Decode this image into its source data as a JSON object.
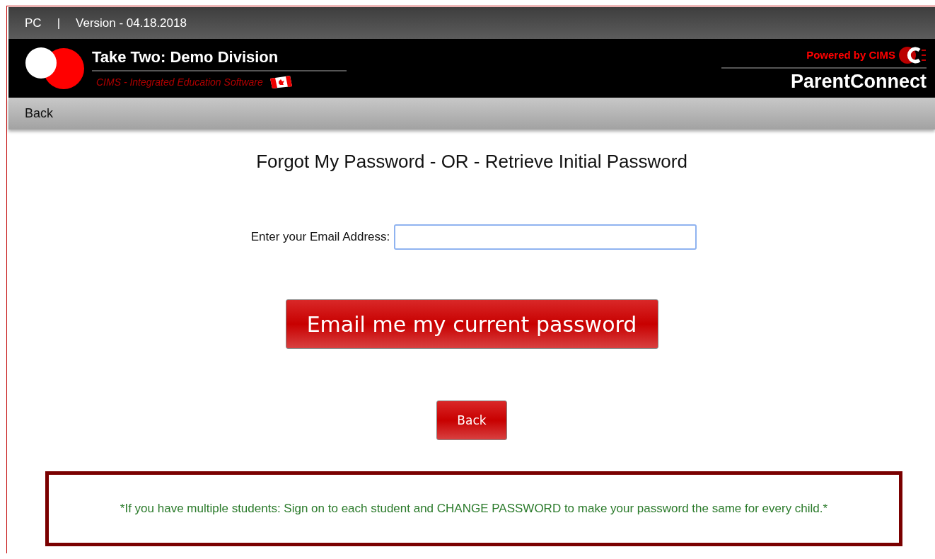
{
  "top_bar": {
    "platform": "PC",
    "separator": "|",
    "version": "Version - 04.18.2018"
  },
  "header": {
    "division": "Take Two: Demo Division",
    "tagline": "CIMS - Integrated Education Software",
    "powered_by": "Powered by CIMS",
    "product": "ParentConnect"
  },
  "nav": {
    "back_link": "Back"
  },
  "form": {
    "title": "Forgot My Password - OR - Retrieve Initial Password",
    "email_label": "Enter your Email Address:",
    "focused": true,
    "submit_button": "Email me my current password",
    "back_button": "Back"
  },
  "notice": "*If you have multiple students: Sign on to each student and CHANGE PASSWORD to make your password the same for every child.*"
}
